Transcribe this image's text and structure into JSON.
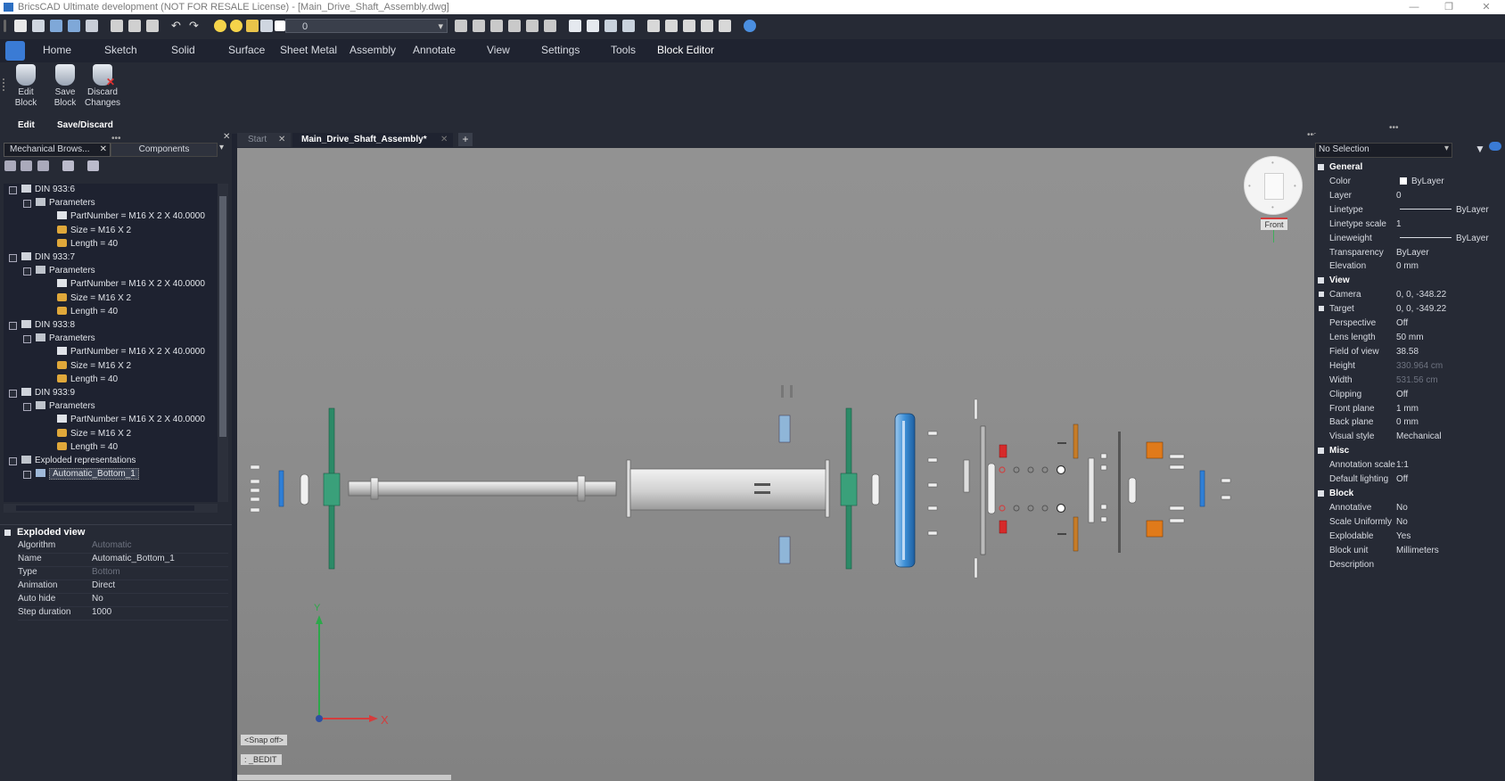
{
  "titlebar": {
    "title": "BricsCAD Ultimate development (NOT FOR RESALE License) - [Main_Drive_Shaft_Assembly.dwg]"
  },
  "toolbar": {
    "layer_combo": "0"
  },
  "ribbon_tabs": [
    "Home",
    "Sketch",
    "Solid",
    "Surface",
    "Sheet Metal",
    "Assembly",
    "Annotate",
    "View",
    "Settings",
    "Tools",
    "Block Editor"
  ],
  "ribbon": {
    "edit_block": [
      "Edit",
      "Block"
    ],
    "save_block": [
      "Save",
      "Block"
    ],
    "discard_changes": [
      "Discard",
      "Changes"
    ],
    "group_edit": "Edit",
    "group_save_discard": "Save/Discard"
  },
  "left_panel": {
    "tab_mech": "Mechanical Brows...",
    "tab_components": "Components",
    "tree": [
      {
        "label": "DIN 933:6",
        "depth": 1,
        "icon": "bolt-icon"
      },
      {
        "label": "Parameters",
        "depth": 2,
        "icon": "folder-icon"
      },
      {
        "label": "PartNumber = M16 X 2 X 40.0000",
        "depth": 3,
        "icon": "param-icon"
      },
      {
        "label": "Size = M16 X 2",
        "depth": 3,
        "icon": "lock-icon"
      },
      {
        "label": "Length = 40",
        "depth": 3,
        "icon": "lock-icon"
      },
      {
        "label": "DIN 933:7",
        "depth": 1,
        "icon": "bolt-icon"
      },
      {
        "label": "Parameters",
        "depth": 2,
        "icon": "folder-icon"
      },
      {
        "label": "PartNumber = M16 X 2 X 40.0000",
        "depth": 3,
        "icon": "param-icon"
      },
      {
        "label": "Size = M16 X 2",
        "depth": 3,
        "icon": "lock-icon"
      },
      {
        "label": "Length = 40",
        "depth": 3,
        "icon": "lock-icon"
      },
      {
        "label": "DIN 933:8",
        "depth": 1,
        "icon": "bolt-icon"
      },
      {
        "label": "Parameters",
        "depth": 2,
        "icon": "folder-icon"
      },
      {
        "label": "PartNumber = M16 X 2 X 40.0000",
        "depth": 3,
        "icon": "param-icon"
      },
      {
        "label": "Size = M16 X 2",
        "depth": 3,
        "icon": "lock-icon"
      },
      {
        "label": "Length = 40",
        "depth": 3,
        "icon": "lock-icon"
      },
      {
        "label": "DIN 933:9",
        "depth": 1,
        "icon": "bolt-icon"
      },
      {
        "label": "Parameters",
        "depth": 2,
        "icon": "folder-icon"
      },
      {
        "label": "PartNumber = M16 X 2 X 40.0000",
        "depth": 3,
        "icon": "param-icon"
      },
      {
        "label": "Size = M16 X 2",
        "depth": 3,
        "icon": "lock-icon"
      },
      {
        "label": "Length = 40",
        "depth": 3,
        "icon": "lock-icon"
      },
      {
        "label": "Exploded representations",
        "depth": 1,
        "icon": "folder-icon"
      },
      {
        "label": "Automatic_Bottom_1",
        "depth": 2,
        "icon": "explode-icon",
        "selected": true
      }
    ],
    "props_title": "Exploded view",
    "props": [
      {
        "k": "Algorithm",
        "v": "Automatic",
        "dim": true
      },
      {
        "k": "Name",
        "v": "Automatic_Bottom_1",
        "dim": false
      },
      {
        "k": "Type",
        "v": "Bottom",
        "dim": true
      },
      {
        "k": "Animation",
        "v": "Direct",
        "dim": false
      },
      {
        "k": "Auto hide",
        "v": "No",
        "dim": false
      },
      {
        "k": "Step duration",
        "v": "1000",
        "dim": false
      }
    ]
  },
  "doc_tabs": {
    "start": "Start",
    "active": "Main_Drive_Shaft_Assembly*",
    "add": "+"
  },
  "viewport": {
    "viewcube_label": "Front",
    "axis_x": "X",
    "axis_y": "Y",
    "snap_status": "<Snap off>",
    "command_line": ": _BEDIT"
  },
  "right_panel": {
    "selection": "No Selection",
    "sections": [
      {
        "title": "General",
        "rows": [
          {
            "k": "Color",
            "v": "ByLayer"
          },
          {
            "k": "Layer",
            "v": "0"
          },
          {
            "k": "Linetype",
            "v": "ByLayer"
          },
          {
            "k": "Linetype scale",
            "v": "1"
          },
          {
            "k": "Lineweight",
            "v": "ByLayer"
          },
          {
            "k": "Transparency",
            "v": "ByLayer"
          },
          {
            "k": "Elevation",
            "v": "0 mm"
          }
        ]
      },
      {
        "title": "View",
        "rows": [
          {
            "k": "Camera",
            "v": "0, 0, -348.22"
          },
          {
            "k": "Target",
            "v": "0, 0, -349.22"
          },
          {
            "k": "Perspective",
            "v": "Off"
          },
          {
            "k": "Lens length",
            "v": "50 mm"
          },
          {
            "k": "Field of view",
            "v": "38.58"
          },
          {
            "k": "Height",
            "v": "330.964 cm",
            "dim": true
          },
          {
            "k": "Width",
            "v": "531.56 cm",
            "dim": true
          },
          {
            "k": "Clipping",
            "v": "Off"
          },
          {
            "k": "Front plane",
            "v": "1 mm"
          },
          {
            "k": "Back plane",
            "v": "0 mm"
          },
          {
            "k": "Visual style",
            "v": "Mechanical"
          }
        ]
      },
      {
        "title": "Misc",
        "rows": [
          {
            "k": "Annotation scale",
            "v": "1:1"
          },
          {
            "k": "Default lighting",
            "v": "Off"
          }
        ]
      },
      {
        "title": "Block",
        "rows": [
          {
            "k": "Annotative",
            "v": "No"
          },
          {
            "k": "Scale Uniformly",
            "v": "No"
          },
          {
            "k": "Explodable",
            "v": "Yes"
          },
          {
            "k": "Block unit",
            "v": "Millimeters"
          },
          {
            "k": "Description",
            "v": ""
          }
        ]
      }
    ]
  },
  "colors": {
    "accent": "#3a7bd5",
    "viewport_bg": "#8e8e8e",
    "panel_bg": "#262a35"
  }
}
